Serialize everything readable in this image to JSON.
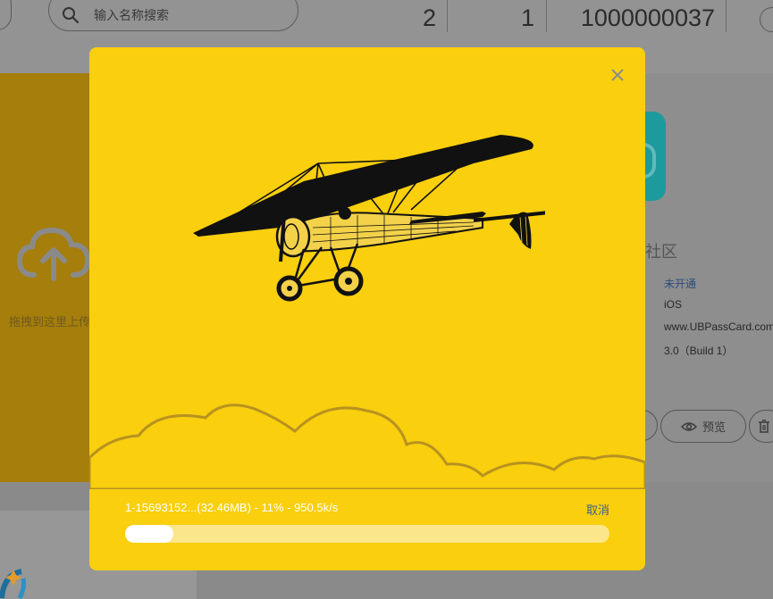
{
  "search": {
    "placeholder": "输入名称搜索"
  },
  "stats": [
    "2",
    "1",
    "1000000037"
  ],
  "upload": {
    "label": "拖拽到这里上传"
  },
  "app": {
    "name_fragment": "社区",
    "status": "未开通",
    "platform": "iOS",
    "url": "www.UBPassCard.com",
    "version": "3.0（Build 1）",
    "preview_label": "预览"
  },
  "modal": {
    "status_text": "1-15693152...(32.46MB) - 11% - 950.5k/s",
    "cancel_label": "取消",
    "progress": 0.1
  },
  "colors": {
    "modal_bg": "#f9cf0e",
    "progress_fill": "#ffffff",
    "progress_track": "#fce68b",
    "cancel_link": "#3b5f8c",
    "upload_card": "#a57e0b",
    "app_icon": "#1d9a9d"
  },
  "icons": [
    "search-icon",
    "upload-cloud-icon",
    "close-icon",
    "eye-icon",
    "trash-icon",
    "airplane-illustration"
  ]
}
